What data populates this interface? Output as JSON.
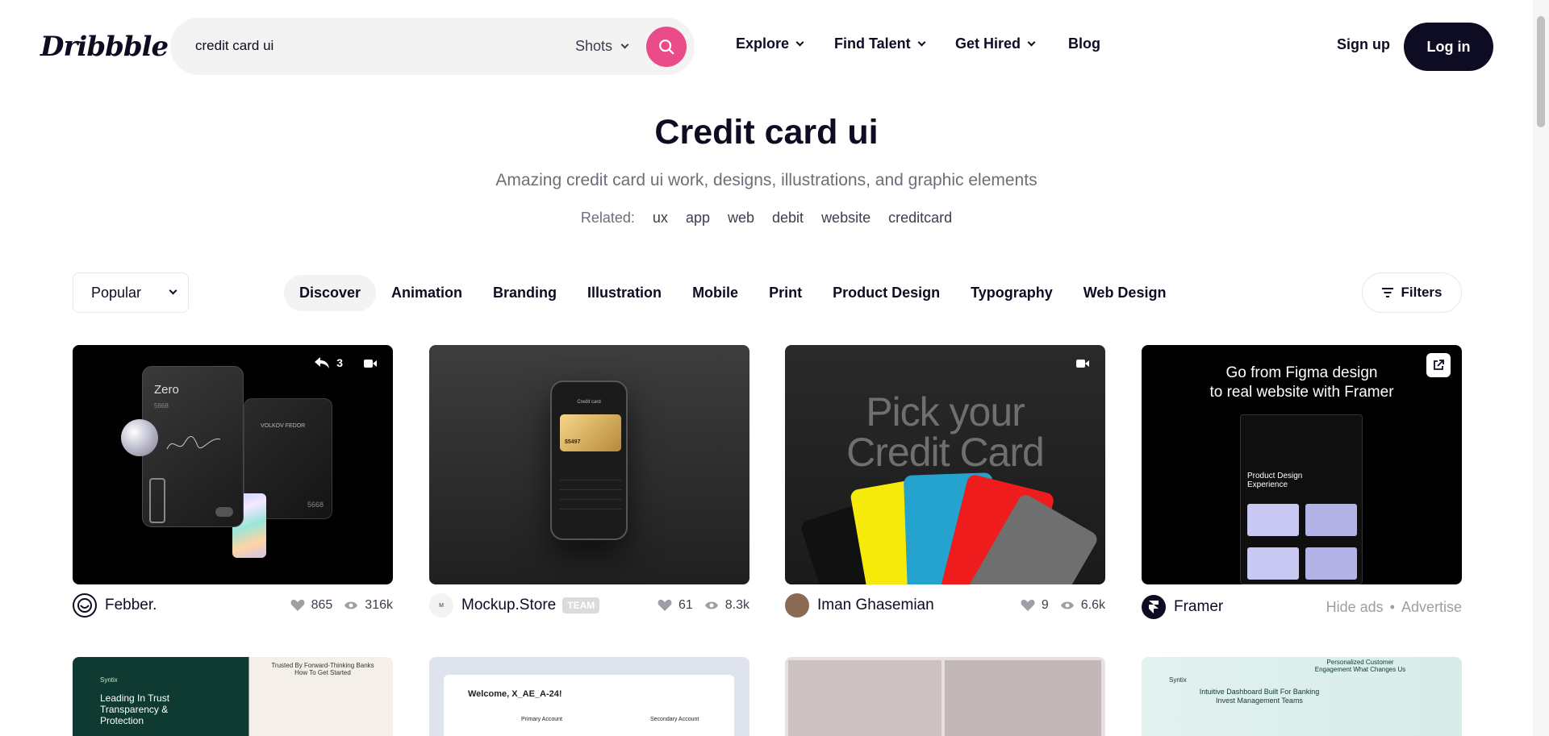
{
  "header": {
    "logo": "Dribbble",
    "search_value": "credit card ui",
    "search_type": "Shots",
    "nav": [
      "Explore",
      "Find Talent",
      "Get Hired",
      "Blog"
    ],
    "signup": "Sign up",
    "login": "Log in"
  },
  "hero": {
    "title": "Credit card ui",
    "subtitle": "Amazing credit card ui work, designs, illustrations, and graphic elements",
    "related_label": "Related:",
    "related": [
      "ux",
      "app",
      "web",
      "debit",
      "website",
      "creditcard"
    ]
  },
  "filterbar": {
    "sort": "Popular",
    "categories": [
      "Discover",
      "Animation",
      "Branding",
      "Illustration",
      "Mobile",
      "Print",
      "Product Design",
      "Typography",
      "Web Design"
    ],
    "filters": "Filters"
  },
  "shots": [
    {
      "author": "Febber.",
      "likes": "865",
      "views": "316k",
      "badge_count": "3",
      "card_brand": "Zero",
      "card_holder": "VOLKOV FEDOR",
      "card_digits": "5668"
    },
    {
      "author": "Mockup.Store",
      "team_badge": "TEAM",
      "likes": "61",
      "views": "8.3k",
      "phone_title": "Credit card",
      "card_balance": "$5497"
    },
    {
      "author": "Iman Ghasemian",
      "likes": "9",
      "views": "6.6k",
      "headline_1": "Pick your",
      "headline_2": "Credit Card"
    },
    {
      "author": "Framer",
      "hide_ads": "Hide ads",
      "separator": "•",
      "advertise": "Advertise",
      "headline_1": "Go from Figma design",
      "headline_2": "to real website with Framer",
      "inner_heading": "Product Design Experience"
    }
  ],
  "row2": [
    {
      "heading": "Leading In Trust Transparency & Protection",
      "tagline": "Trusted By Forward-Thinking Banks How To Get Started",
      "brand": "Syntix"
    },
    {
      "heading": "Welcome, X_AE_A-24!",
      "tab1": "Primary Account",
      "tab2": "Secondary Account"
    },
    {},
    {
      "brand": "Syntix",
      "heading": "Intuitive Dashboard Built For Banking Invest Management Teams",
      "tagline": "Personalized Customer Engagement What Changes Us"
    }
  ],
  "colors": {
    "brand_pink": "#ea4c89",
    "ink": "#0d0c22",
    "muted": "#6e6d7a"
  }
}
